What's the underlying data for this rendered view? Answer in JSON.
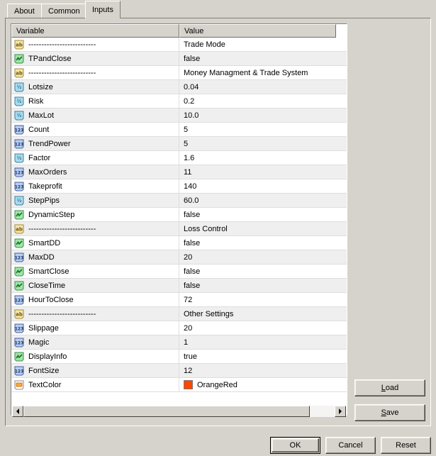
{
  "tabs": [
    {
      "label": "About",
      "active": false
    },
    {
      "label": "Common",
      "active": false
    },
    {
      "label": "Inputs",
      "active": true
    }
  ],
  "table": {
    "headers": {
      "variable": "Variable",
      "value": "Value"
    },
    "rows": [
      {
        "icon": "string-icon",
        "name": "--------------------------",
        "value": "Trade Mode"
      },
      {
        "icon": "bool-icon",
        "name": "TPandClose",
        "value": "false"
      },
      {
        "icon": "string-icon",
        "name": "--------------------------",
        "value": "Money Managment & Trade System"
      },
      {
        "icon": "double-icon",
        "name": "Lotsize",
        "value": "0.04"
      },
      {
        "icon": "double-icon",
        "name": "Risk",
        "value": "0.2"
      },
      {
        "icon": "double-icon",
        "name": "MaxLot",
        "value": "10.0"
      },
      {
        "icon": "int-icon",
        "name": "Count",
        "value": "5"
      },
      {
        "icon": "int-icon",
        "name": "TrendPower",
        "value": "5"
      },
      {
        "icon": "double-icon",
        "name": "Factor",
        "value": "1.6"
      },
      {
        "icon": "int-icon",
        "name": "MaxOrders",
        "value": "11"
      },
      {
        "icon": "int-icon",
        "name": "Takeprofit",
        "value": "140"
      },
      {
        "icon": "double-icon",
        "name": "StepPips",
        "value": "60.0"
      },
      {
        "icon": "bool-icon",
        "name": "DynamicStep",
        "value": "false"
      },
      {
        "icon": "string-icon",
        "name": "--------------------------",
        "value": "Loss Control"
      },
      {
        "icon": "bool-icon",
        "name": "SmartDD",
        "value": "false"
      },
      {
        "icon": "int-icon",
        "name": "MaxDD",
        "value": "20"
      },
      {
        "icon": "bool-icon",
        "name": "SmartClose",
        "value": "false"
      },
      {
        "icon": "bool-icon",
        "name": "CloseTime",
        "value": "false"
      },
      {
        "icon": "int-icon",
        "name": "HourToClose",
        "value": "72"
      },
      {
        "icon": "string-icon",
        "name": "--------------------------",
        "value": "Other Settings"
      },
      {
        "icon": "int-icon",
        "name": "Slippage",
        "value": "20"
      },
      {
        "icon": "int-icon",
        "name": "Magic",
        "value": "1"
      },
      {
        "icon": "bool-icon",
        "name": "DisplayInfo",
        "value": "true"
      },
      {
        "icon": "int-icon",
        "name": "FontSize",
        "value": "12"
      },
      {
        "icon": "color-icon",
        "name": "TextColor",
        "value": "OrangeRed",
        "swatch": "#FF4500"
      }
    ]
  },
  "scrollbar": {
    "left_arrow": "scroll-left-icon",
    "right_arrow": "scroll-right-icon",
    "thumb_percent": 92
  },
  "buttons": {
    "load": {
      "label": "Load",
      "mnemonic": "L"
    },
    "save": {
      "label": "Save",
      "mnemonic": "S"
    },
    "ok": {
      "label": "OK",
      "default": true
    },
    "cancel": {
      "label": "Cancel"
    },
    "reset": {
      "label": "Reset"
    }
  },
  "colors": {
    "face": "#d6d3cc",
    "row_alt": "#efefef",
    "accent_swatch": "#FF4500"
  }
}
